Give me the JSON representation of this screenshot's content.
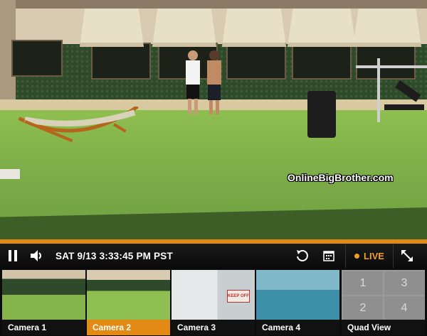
{
  "player": {
    "timestamp": "SAT 9/13 3:33:45 PM PST",
    "live_label": "LIVE",
    "watermark": "OnlineBigBrother.com",
    "accent_color": "#e28a14"
  },
  "icons": {
    "pause": "pause-icon",
    "volume": "volume-icon",
    "replay": "replay-icon",
    "calendar": "calendar-icon",
    "live": "live-dot-icon",
    "expand": "expand-icon"
  },
  "cameras": [
    {
      "label": "Camera 1",
      "active": false
    },
    {
      "label": "Camera 2",
      "active": true
    },
    {
      "label": "Camera 3",
      "active": false
    },
    {
      "label": "Camera 4",
      "active": false
    },
    {
      "label": "Quad View",
      "active": false
    }
  ],
  "quad_numbers": [
    "1",
    "3",
    "2",
    "4"
  ],
  "scene": {
    "sign_text": "KEEP OFF"
  }
}
